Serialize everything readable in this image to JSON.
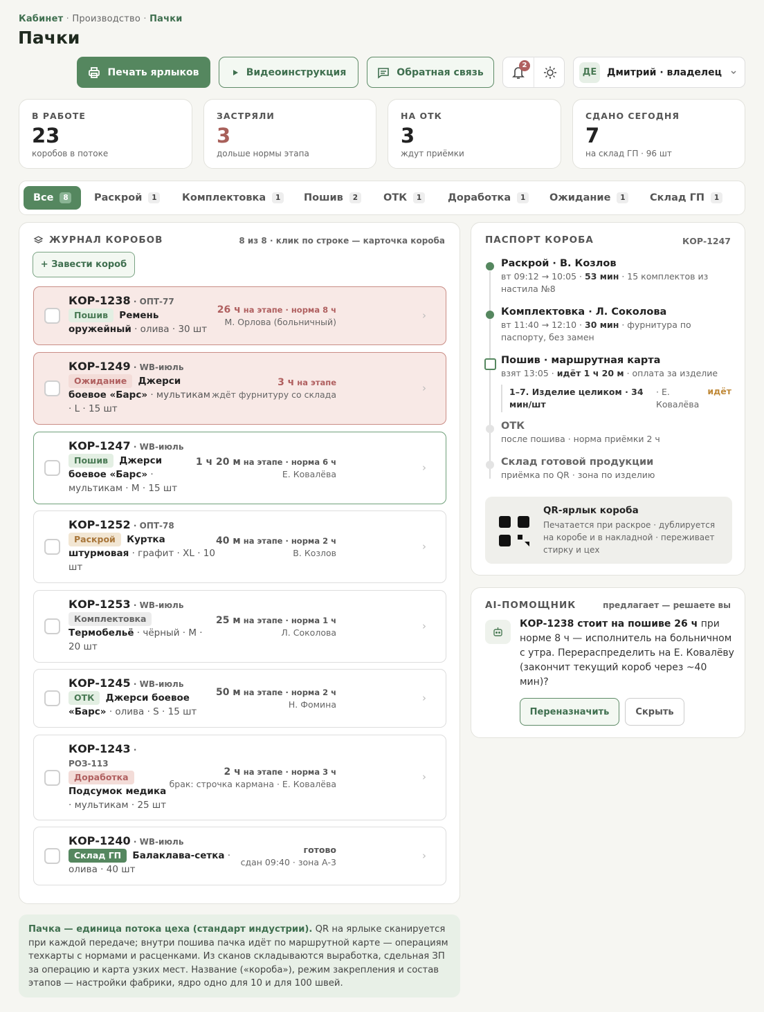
{
  "breadcrumb": {
    "root": "Кабинет",
    "mid": "Производство",
    "current": "Пачки",
    "sep": "·"
  },
  "page_title": "Пачки",
  "toolbar": {
    "print": "Печать ярлыков",
    "video": "Видеоинструкция",
    "feedback": "Обратная связь",
    "notif_count": "2"
  },
  "user": {
    "initials": "ДЕ",
    "name": "Дмитрий · владелец"
  },
  "stats": [
    {
      "label": "В РАБОТЕ",
      "value": "23",
      "sub": "коробов в потоке",
      "value_color": "#222222"
    },
    {
      "label": "ЗАСТРЯЛИ",
      "value": "3",
      "sub": "дольше нормы этапа",
      "value_color": "#a8605a"
    },
    {
      "label": "НА ОТК",
      "value": "3",
      "sub": "ждут приёмки",
      "value_color": "#222222"
    },
    {
      "label": "СДАНО СЕГОДНЯ",
      "value": "7",
      "sub": "на склад ГП · 96 шт",
      "value_color": "#222222"
    }
  ],
  "tabs": [
    {
      "label": "Все",
      "count": "8"
    },
    {
      "label": "Раскрой",
      "count": "1"
    },
    {
      "label": "Комплектовка",
      "count": "1"
    },
    {
      "label": "Пошив",
      "count": "2"
    },
    {
      "label": "ОТК",
      "count": "1"
    },
    {
      "label": "Доработка",
      "count": "1"
    },
    {
      "label": "Ожидание",
      "count": "1"
    },
    {
      "label": "Склад ГП",
      "count": "1"
    }
  ],
  "journal": {
    "title": "ЖУРНАЛ КОРОБОВ",
    "info": "8 из 8 · клик по строке — карточка короба",
    "add": "+ Завести короб"
  },
  "rows": [
    {
      "id": "КОР-1238",
      "src": "· ОПТ-77",
      "stage": "Пошив",
      "name": "Ремень оружейный",
      "meta": "· олива · 30 шт",
      "time": "26 ч",
      "time_suffix": " на этапе · норма 8 ч",
      "who": "М. Орлова (больничный)"
    },
    {
      "id": "КОР-1249",
      "src": "· WB-июль",
      "stage": "Ожидание",
      "name": "Джерси боевое «Барс»",
      "meta": "· мультикам · L · 15 шт",
      "time": "3 ч",
      "time_suffix": " на этапе",
      "who": "ждёт фурнитуру со склада"
    },
    {
      "id": "КОР-1247",
      "src": "· WB-июль",
      "stage": "Пошив",
      "name": "Джерси боевое «Барс»",
      "meta": "· мультикам · M · 15 шт",
      "time": "1 ч 20 м",
      "time_suffix": " на этапе · норма 6 ч",
      "who": "Е. Ковалёва"
    },
    {
      "id": "КОР-1252",
      "src": "· ОПТ-78",
      "stage": "Раскрой",
      "name": "Куртка штурмовая",
      "meta": "· графит · XL · 10 шт",
      "time": "40 м",
      "time_suffix": " на этапе · норма 2 ч",
      "who": "В. Козлов"
    },
    {
      "id": "КОР-1253",
      "src": "· WB-июль",
      "stage": "Комплектовка",
      "name": "Термобельё",
      "meta": "· чёрный · M · 20 шт",
      "time": "25 м",
      "time_suffix": " на этапе · норма 1 ч",
      "who": "Л. Соколова"
    },
    {
      "id": "КОР-1245",
      "src": "· WB-июль",
      "stage": "ОТК",
      "name": "Джерси боевое «Барс»",
      "meta": "· олива · S · 15 шт",
      "time": "50 м",
      "time_suffix": " на этапе · норма 2 ч",
      "who": "Н. Фомина"
    },
    {
      "id": "КОР-1243",
      "src": "· РОЗ-113",
      "stage": "Доработка",
      "name": "Подсумок медика",
      "meta": "· мультикам · 25 шт",
      "time": "2 ч",
      "time_suffix": " на этапе · норма 3 ч",
      "who": "брак: строчка кармана · Е. Ковалёва"
    },
    {
      "id": "КОР-1240",
      "src": "· WB-июль",
      "stage": "Склад ГП",
      "name": "Балаклава-сетка",
      "meta": "· олива · 40 шт",
      "time": "готово",
      "time_suffix": "",
      "who": "сдан 09:40 · зона А-3"
    }
  ],
  "passport": {
    "title": "ПАСПОРТ КОРОБА",
    "box_id": "КОР-1247",
    "steps": [
      {
        "head": "Раскрой · В. Козлов",
        "line1": "вт 09:12 → 10:05 · ",
        "bold": "53 мин",
        "line2": " · 15 комплектов из настила №8"
      },
      {
        "head": "Комплектовка · Л. Соколова",
        "line1": "вт 11:40 → 12:10 · ",
        "bold": "30 мин",
        "line2": " · фурнитура по паспорту, без замен"
      },
      {
        "head": "Пошив · маршрутная карта",
        "line1": "взят 13:05 · ",
        "bold": "идёт 1 ч 20 м",
        "line2": " · оплата за изделие"
      },
      {
        "head": "ОТК",
        "line1": "после пошива · норма приёмки 2 ч",
        "bold": "",
        "line2": ""
      },
      {
        "head": "Склад готовой продукции",
        "line1": "приёмка по QR · зона по изделию",
        "bold": "",
        "line2": ""
      }
    ],
    "op": {
      "name": "1–7. Изделие целиком · 34 мин/шт",
      "who": "· Е. Ковалёва",
      "status": "идёт"
    },
    "qr": {
      "title": "QR-ярлык короба",
      "text": "Печатается при раскрое · дублируется на коробе и в накладной · переживает стирку и цех"
    }
  },
  "ai": {
    "title": "AI-ПОМОЩНИК",
    "hint": "предлагает — решаете вы",
    "bold": "КОР-1238 стоит на пошиве 26 ч",
    "text": " при норме 8 ч — исполнитель на больничном с утра. Перераспределить на Е. Ковалёву (закончит текущий короб через ~40 мин)?",
    "reassign": "Переназначить",
    "hide": "Скрыть"
  },
  "note": {
    "bold": "Пачка — единица потока цеха (стандарт индустрии).",
    "text": " QR на ярлыке сканируется при каждой передаче; внутри пошива пачка идёт по маршрутной карте — операциям техкарты с нормами и расценками. Из сканов складываются выработка, сдельная ЗП за операцию и карта узких мест. Название («короба»), режим закрепления и состав этапов — настройки фабрики, ядро одно для 10 и для 100 швей."
  },
  "colors": {
    "accent": "#55875f",
    "danger": "#b06060",
    "warn_bg": "#f8e9e6"
  }
}
